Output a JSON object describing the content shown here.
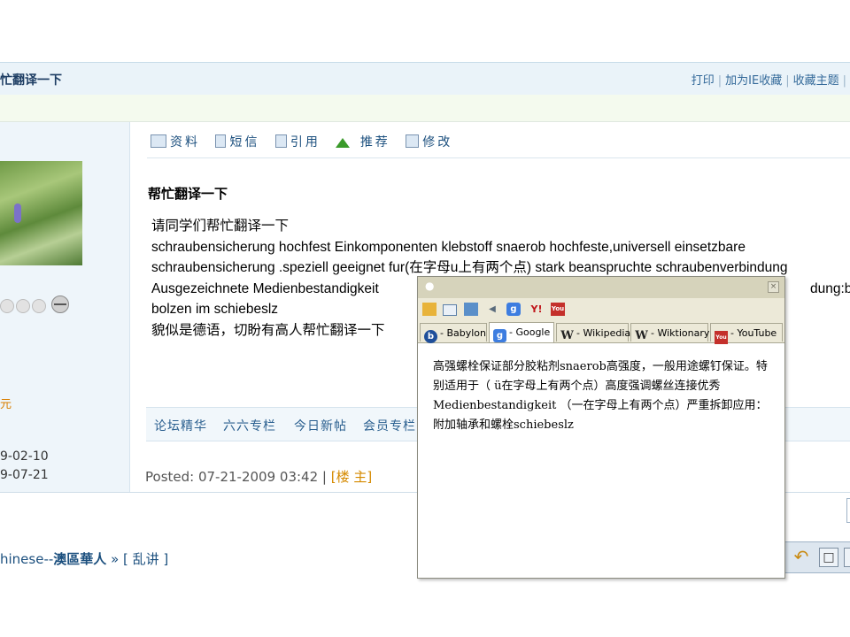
{
  "header": {
    "thread_title": "忙翻译一下",
    "actions": [
      "打印",
      "加为IE收藏",
      "收藏主题"
    ]
  },
  "user": {
    "money_label": "元",
    "register_date": "9-02-10",
    "last_login": "9-07-21"
  },
  "post_toolbar": {
    "items": [
      {
        "label": "资料",
        "icon": "profile-icon"
      },
      {
        "label": "短信",
        "icon": "message-icon"
      },
      {
        "label": "引用",
        "icon": "quote-icon"
      },
      {
        "label": "推荐",
        "icon": "recommend-arrow-icon"
      },
      {
        "label": "修改",
        "icon": "edit-icon"
      }
    ]
  },
  "post": {
    "title": "帮忙翻译一下",
    "lines": [
      "请同学们帮忙翻译一下",
      "schraubensicherung  hochfest  Einkomponenten  klebstoff  snaerob hochfeste,universell einsetzbare",
      "schraubensicherung .speziell  geeignet  fur(在字母u上有两个点)  stark  beanspruchte  schraubenverbindung",
      "Ausgezeichnete  Medienbestandigkeit",
      "bolzen im schiebeslz",
      "貌似是德语，切盼有高人帮忙翻译一下"
    ],
    "line3_tail": "dung:befe",
    "posted": "Posted: 07-21-2009 03:42 |",
    "floor": "[楼 主]"
  },
  "quick_links": [
    "论坛精华",
    "六六专栏",
    "今日新帖",
    "会员专栏"
  ],
  "breadcrumb": {
    "forum": "hinese--",
    "forum_name": "澳區華人",
    "sep": "»",
    "current": "[ 乱讲 ]"
  },
  "popup": {
    "tabs": [
      "- Babylon",
      "- Google",
      "- Wikipedia",
      "- Wiktionary",
      "- YouTube"
    ],
    "active_tab": "- Google",
    "translation": "高强螺栓保证部分胶粘剂snaerob高强度，一般用途螺钉保证。特别适用于（ ü在字母上有两个点）高度强调螺丝连接优秀Medienbestandigkeit （一在字母上有两个点）严重拆卸应用：附加轴承和螺栓schiebeslz"
  },
  "colors": {
    "link": "#1b4f7e",
    "accent_orange": "#d58a00",
    "header_bg": "#eaf3f9",
    "popup_title_bg": "#d6d3bb"
  }
}
